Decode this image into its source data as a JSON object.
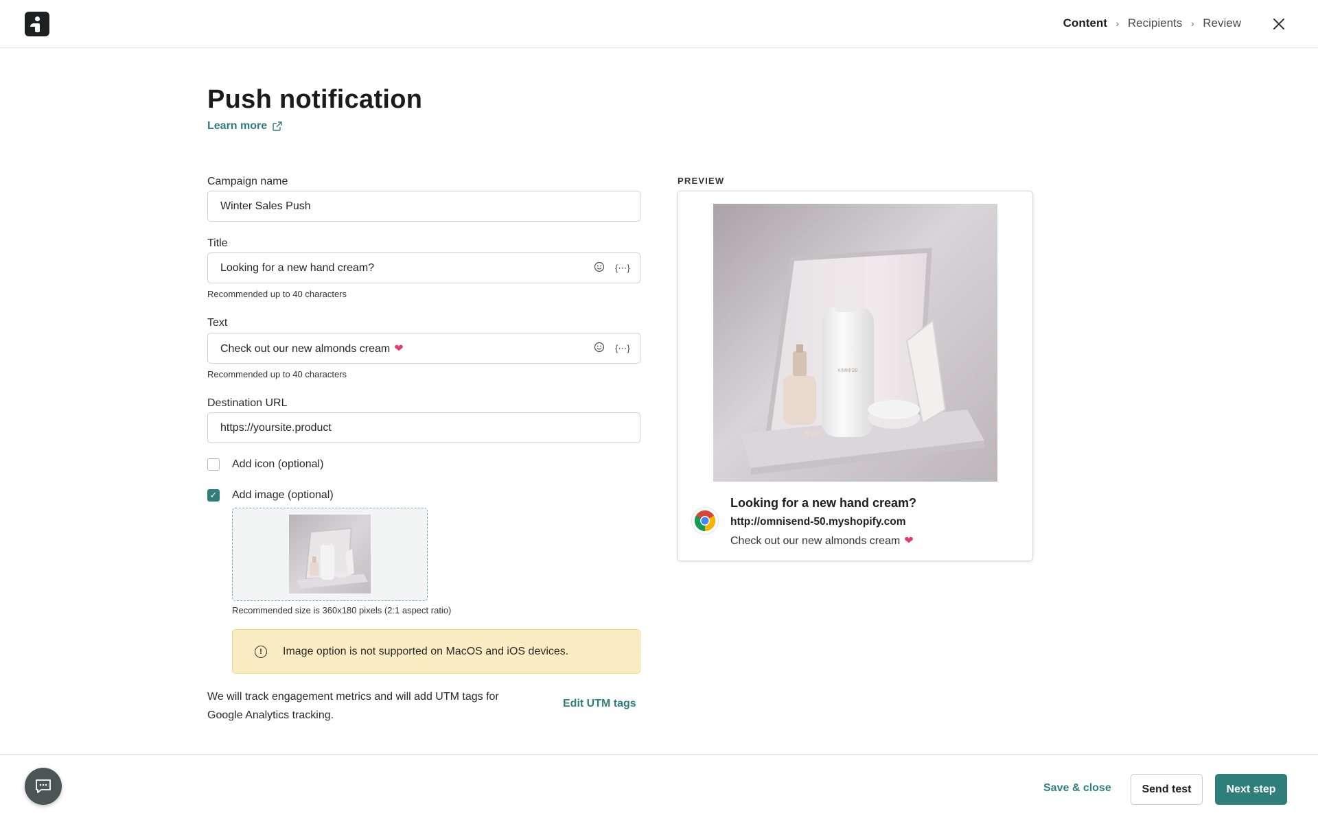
{
  "header": {
    "steps": [
      {
        "label": "Content",
        "active": true
      },
      {
        "label": "Recipients",
        "active": false
      },
      {
        "label": "Review",
        "active": false
      }
    ],
    "close_icon": "close-icon"
  },
  "page": {
    "title": "Push notification",
    "learn_more": "Learn more"
  },
  "form": {
    "campaign_name": {
      "label": "Campaign name",
      "value": "Winter Sales Push"
    },
    "title": {
      "label": "Title",
      "value": "Looking for a new hand cream?",
      "hint": "Recommended up to 40 characters"
    },
    "text": {
      "label": "Text",
      "value": "Check out our new almonds cream",
      "emoji": "❤",
      "hint": "Recommended up to 40 characters"
    },
    "destination_url": {
      "label": "Destination URL",
      "value": "https://yoursite.product"
    },
    "add_icon": {
      "label": "Add icon (optional)",
      "checked": false
    },
    "add_image": {
      "label": "Add image (optional)",
      "checked": true
    },
    "image_size_hint": "Recommended size is 360x180 pixels (2:1 aspect ratio)",
    "warning": "Image option is not supported on MacOS and iOS devices.",
    "utm_text": "We will track engagement metrics and will add UTM tags for Google Analytics tracking.",
    "utm_link": "Edit UTM tags"
  },
  "preview": {
    "label": "PREVIEW",
    "title": "Looking for a new hand cream?",
    "url": "http://omnisend-50.myshopify.com",
    "text": "Check out our new almonds cream",
    "emoji": "❤",
    "browser_icon": "chrome-icon"
  },
  "footer": {
    "save_close": "Save & close",
    "send_test": "Send test",
    "next_step": "Next step"
  },
  "colors": {
    "accent": "#2e7f7c",
    "warning_bg": "#fbedc3",
    "heart": "#e33a6c"
  }
}
